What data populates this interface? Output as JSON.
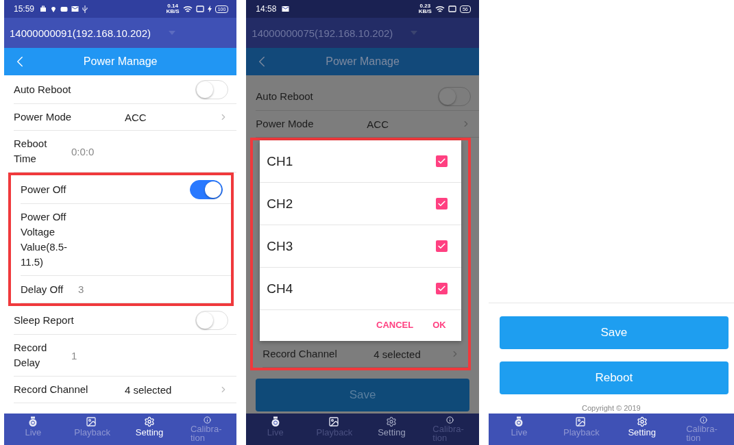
{
  "screens": [
    {
      "kind": "settings",
      "dimmed": false,
      "status_bar": {
        "time": "15:59",
        "notifications": [
          {
            "kind": "briefcase"
          },
          {
            "kind": "pin"
          },
          {
            "kind": "game"
          },
          {
            "kind": "mail"
          },
          {
            "kind": "usb"
          }
        ],
        "speed": "0.14",
        "speed_unit": "KB/S",
        "charging": true,
        "battery": "100"
      },
      "device": "14000000091(192.168.10.202)",
      "title": "Power Manage",
      "rows": [
        {
          "kind": "toggle",
          "label": "Auto Reboot",
          "on": false,
          "highlighted": false
        },
        {
          "kind": "select",
          "label": "Power Mode",
          "value": "ACC",
          "highlighted": false
        },
        {
          "kind": "input",
          "label": "Reboot Time",
          "value": "0:0:0",
          "highlighted": false
        },
        {
          "kind": "toggle",
          "label": "Power Off",
          "on": true,
          "highlighted": true
        },
        {
          "kind": "input",
          "label": "Power Off Voltage Value(8.5-11.5)",
          "highlighted": true
        },
        {
          "kind": "input",
          "label": "Delay Off",
          "value": "3",
          "highlighted": true
        },
        {
          "kind": "toggle",
          "label": "Sleep Report",
          "on": false,
          "highlighted": false
        },
        {
          "kind": "input",
          "label": "Record Delay",
          "value": "1",
          "highlighted": false
        },
        {
          "kind": "select",
          "label": "Record Channel",
          "value": "4 selected",
          "highlighted": false
        }
      ],
      "nav": [
        {
          "label": "Live",
          "selected": false
        },
        {
          "label": "Playback",
          "selected": false
        },
        {
          "label": "Setting",
          "selected": true
        },
        {
          "label": "Calibra-tion",
          "selected": false
        }
      ]
    },
    {
      "kind": "dialog",
      "dimmed": true,
      "status_bar": {
        "time": "14:58",
        "notifications": [
          {
            "kind": "mail"
          }
        ],
        "speed": "0.23",
        "speed_unit": "KB/S",
        "charging": false,
        "battery": "56"
      },
      "device": "14000000075(192.168.10.202)",
      "title": "Power Manage",
      "rows": [
        {
          "kind": "toggle",
          "label": "Auto Reboot",
          "on": false
        },
        {
          "kind": "select",
          "label": "Power Mode",
          "value": "ACC"
        }
      ],
      "dialog": {
        "options": [
          {
            "label": "CH1",
            "checked": true
          },
          {
            "label": "CH2",
            "checked": true
          },
          {
            "label": "CH3",
            "checked": true
          },
          {
            "label": "CH4",
            "checked": true
          }
        ],
        "cancel": "CANCEL",
        "ok": "OK"
      },
      "after_row": {
        "kind": "select",
        "label": "Record Channel",
        "value": "4 selected"
      },
      "buttons": [
        "Save"
      ],
      "nav": [
        {
          "label": "Live",
          "selected": false
        },
        {
          "label": "Playback",
          "selected": false
        },
        {
          "label": "Setting",
          "selected": true
        },
        {
          "label": "Calibra-tion",
          "selected": false
        }
      ]
    },
    {
      "kind": "actions",
      "dimmed": false,
      "buttons": [
        "Save",
        "Reboot"
      ],
      "copyright": "Copyright © 2019",
      "nav": [
        {
          "label": "Live",
          "selected": false
        },
        {
          "label": "Playback",
          "selected": false
        },
        {
          "label": "Setting",
          "selected": true
        },
        {
          "label": "Calibra-tion",
          "selected": false
        }
      ]
    }
  ]
}
